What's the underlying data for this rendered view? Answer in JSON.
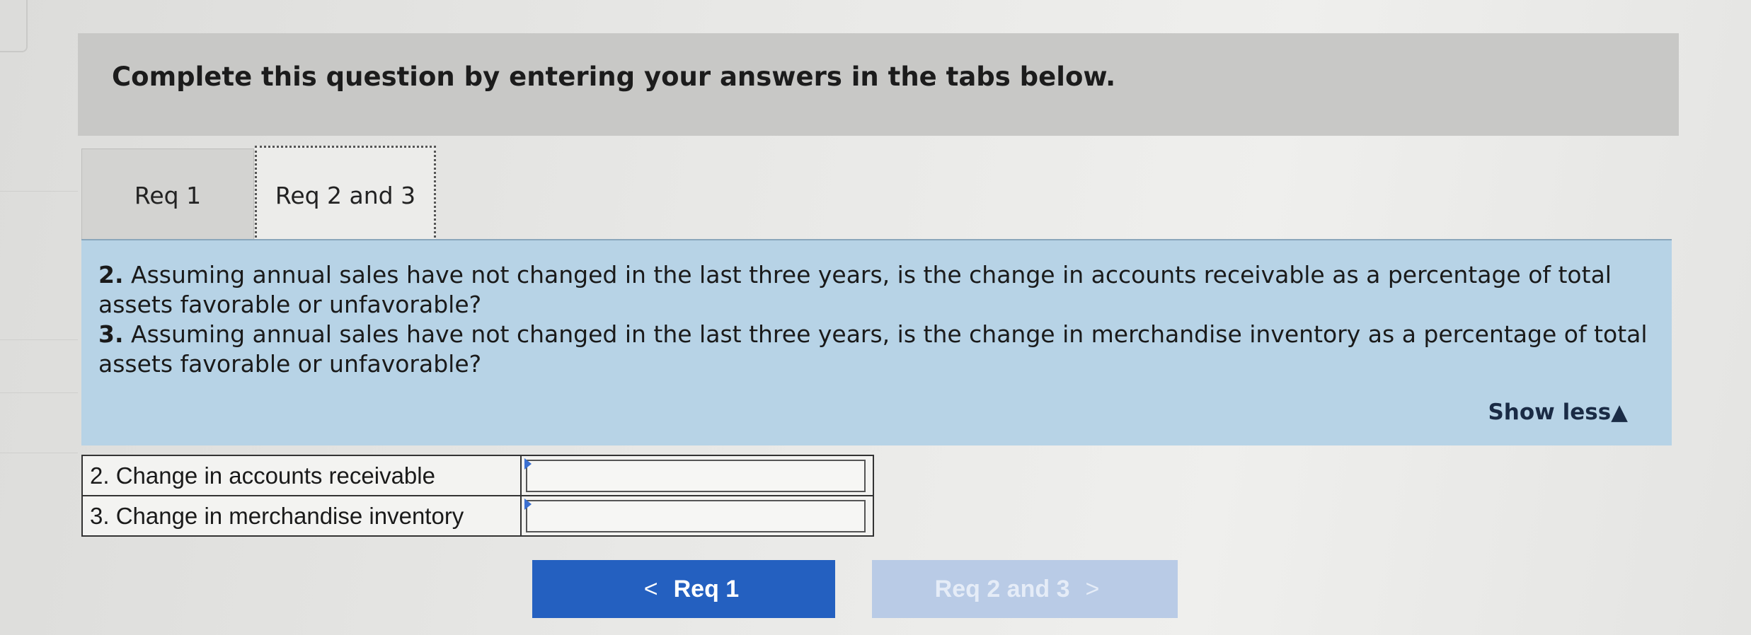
{
  "header": {
    "title": "Complete this question by entering your answers in the tabs below."
  },
  "tabs": [
    {
      "label": "Req 1",
      "active": false
    },
    {
      "label": "Req 2 and 3",
      "active": true
    }
  ],
  "instructions": {
    "q2_number": "2.",
    "q2_text": "Assuming annual sales have not changed in the last three years, is the change in accounts receivable as a percentage of total assets favorable or unfavorable?",
    "q3_number": "3.",
    "q3_text": "Assuming annual sales have not changed in the last three years, is the change in merchandise inventory as a percentage of total assets favorable or unfavorable?",
    "show_less": "Show less▲"
  },
  "answers": {
    "rows": [
      {
        "label": "2. Change in accounts receivable",
        "value": ""
      },
      {
        "label": "3. Change in merchandise inventory",
        "value": ""
      }
    ]
  },
  "nav": {
    "prev_label": "Req 1",
    "prev_chevron": "<",
    "next_label": "Req 2 and 3",
    "next_chevron": ">"
  },
  "colors": {
    "panel": "#b7d3e6",
    "primary_button": "#2460c0",
    "disabled_button": "#b9cbe6"
  }
}
